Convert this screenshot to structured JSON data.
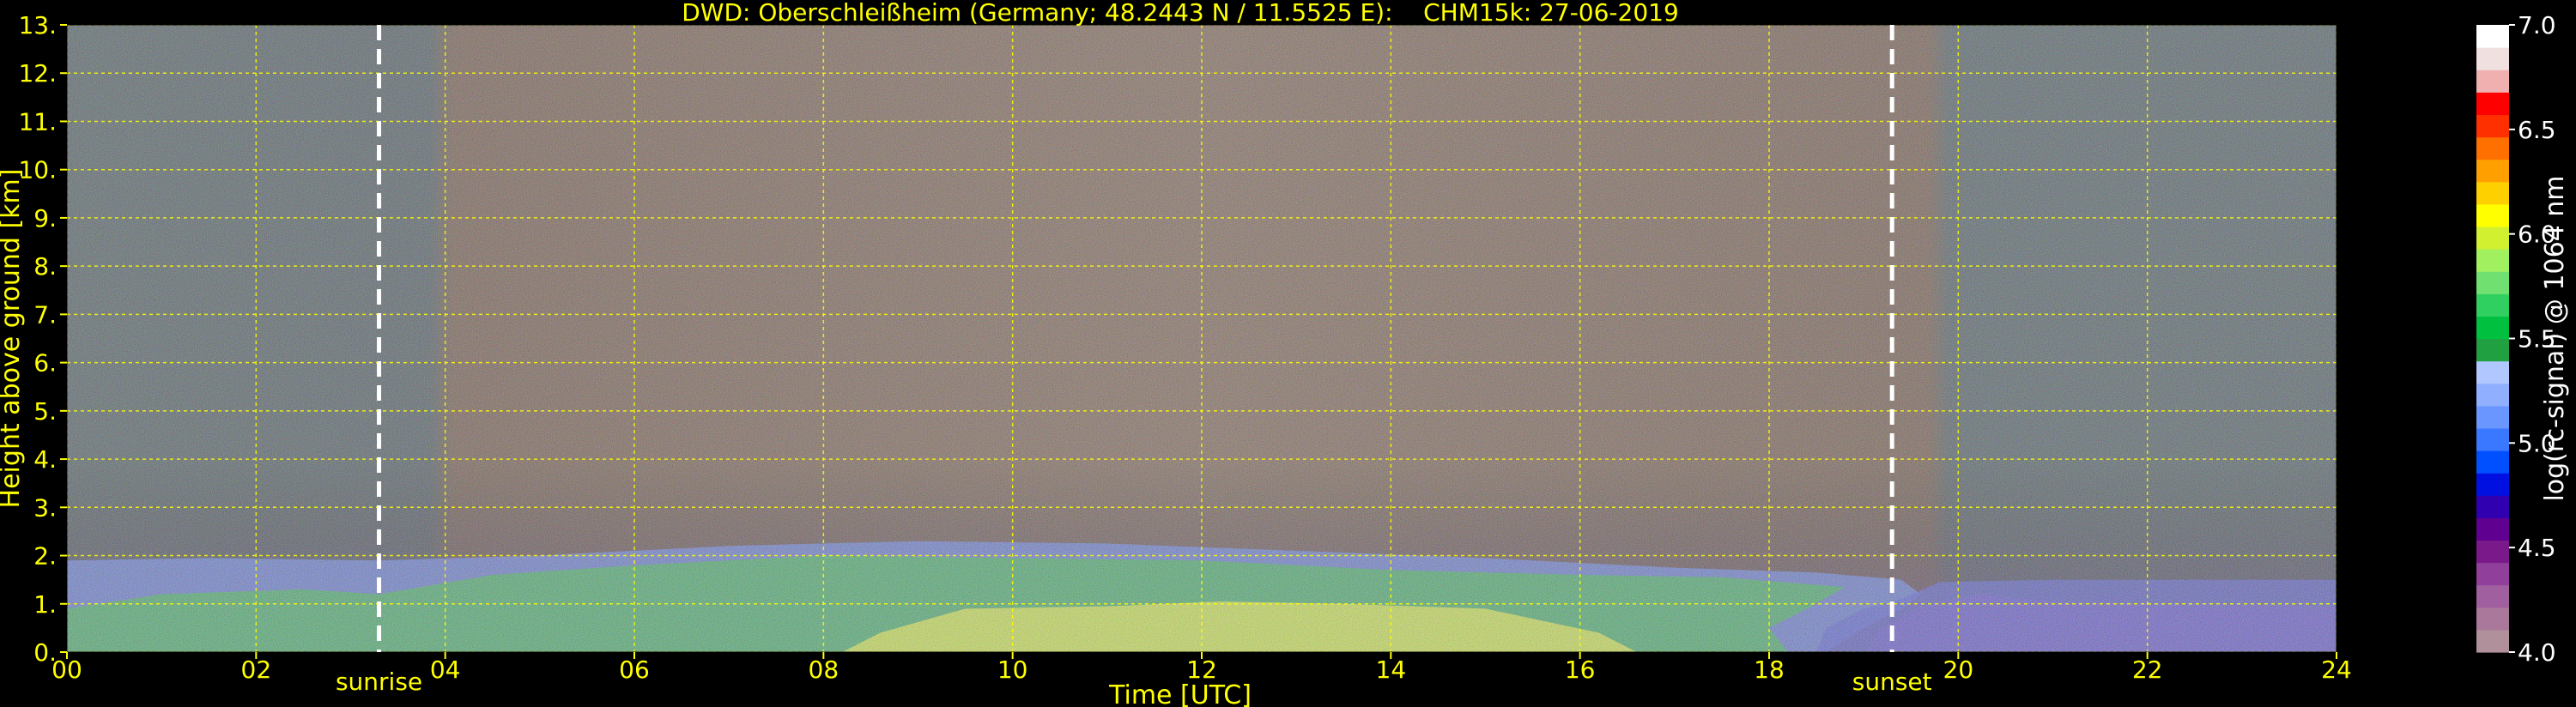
{
  "chart_data": {
    "type": "heatmap",
    "title": "DWD: Oberschleißheim (Germany; 48.2443 N / 11.5525 E):    CHM15k: 27-06-2019",
    "xlabel": "Time [UTC]",
    "ylabel": "Height above ground [km]",
    "xlim": [
      0,
      24
    ],
    "ylim": [
      0,
      13
    ],
    "x_ticks": [
      "00",
      "02",
      "04",
      "06",
      "08",
      "10",
      "12",
      "14",
      "16",
      "18",
      "20",
      "22",
      "24"
    ],
    "y_ticks": [
      "0.",
      "1.",
      "2.",
      "3.",
      "4.",
      "5.",
      "6.",
      "7.",
      "8.",
      "9.",
      "10.",
      "11.",
      "12.",
      "13."
    ],
    "grid": true,
    "grid_color": "#ffff00",
    "text_color": "#ffff00",
    "markers": [
      {
        "label": "sunrise",
        "x": 3.3
      },
      {
        "label": "sunset",
        "x": 19.3
      }
    ],
    "colorbar": {
      "label": "log(rc-signal) @ 1064 nm",
      "range": [
        4.0,
        7.0
      ],
      "ticks": [
        "4.0",
        "4.5",
        "5.0",
        "5.5",
        "6.0",
        "6.5",
        "7.0"
      ],
      "colors": [
        "#b0909a",
        "#a9789a",
        "#a060a0",
        "#90409a",
        "#7a1a8a",
        "#600090",
        "#3000b0",
        "#0010e0",
        "#0050ff",
        "#3a78ff",
        "#6a96ff",
        "#90b0ff",
        "#b0c8ff",
        "#20a040",
        "#00c040",
        "#30d060",
        "#70e070",
        "#a0f060",
        "#d0f030",
        "#ffff00",
        "#ffd000",
        "#ffa000",
        "#ff7000",
        "#ff3000",
        "#ff0000",
        "#f0b0b0",
        "#f0e0e0",
        "#ffffff"
      ]
    },
    "layers": [
      {
        "name": "",
        "region": "upper-atmosphere noise",
        "y": [
          3,
          13
        ],
        "value_range": [
          4.0,
          7.0
        ]
      },
      {
        "name": "",
        "region": "boundary layer",
        "y": [
          0,
          2.3
        ],
        "value_range": [
          5.0,
          6.0
        ]
      },
      {
        "name": "",
        "region": "nocturnal residual layer",
        "x": [
          18.5,
          24
        ],
        "y": [
          0,
          1.5
        ],
        "value_range": [
          4.3,
          4.8
        ]
      }
    ]
  }
}
